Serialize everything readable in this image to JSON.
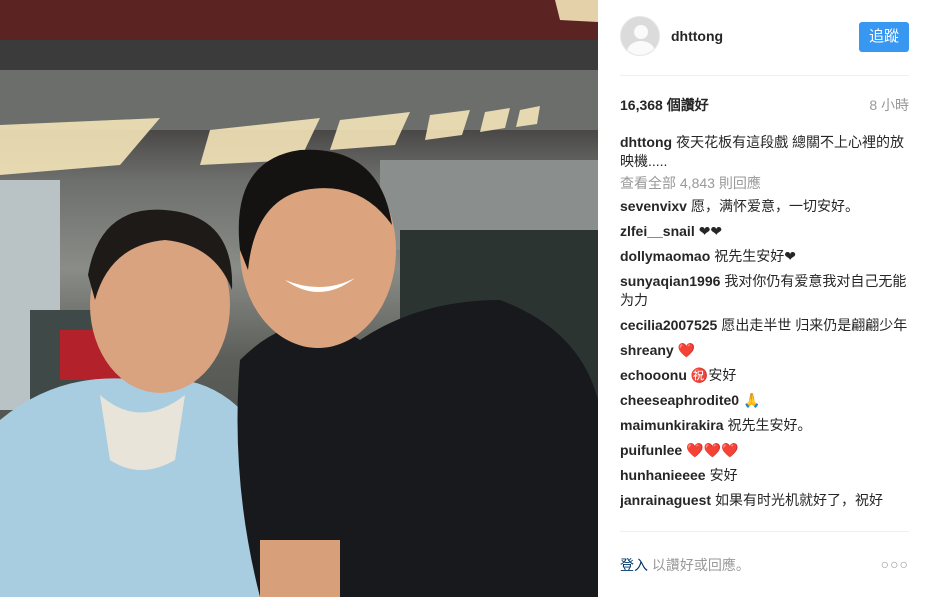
{
  "post": {
    "username": "dhttong",
    "follow_label": "追蹤",
    "likes": "16,368 個讚好",
    "time_ago": "8 小時",
    "caption": {
      "username": "dhttong",
      "text": "夜天花板有這段戲 總關不上心裡的放映機....."
    },
    "view_all": "查看全部 4,843 則回應",
    "comments": [
      {
        "username": "sevenvixv",
        "text": "愿，满怀爱意，一切安好。"
      },
      {
        "username": "zlfei__snail",
        "text": "❤❤"
      },
      {
        "username": "dollymaomao",
        "text": "祝先生安好❤"
      },
      {
        "username": "sunyaqian1996",
        "text": "我对你仍有爱意我对自己无能为力"
      },
      {
        "username": "cecilia2007525",
        "text": "愿出走半世 归来仍是翩翩少年"
      },
      {
        "username": "shreany",
        "text": "❤️"
      },
      {
        "username": "echooonu",
        "text": "㊗️安好"
      },
      {
        "username": "cheeseaphrodite0",
        "text": "🙏"
      },
      {
        "username": "maimunkirakira",
        "text": "祝先生安好。"
      },
      {
        "username": "puifunlee",
        "text": "❤️❤️❤️"
      },
      {
        "username": "hunhanieeee",
        "text": "安好"
      },
      {
        "username": "janrainaguest",
        "text": "如果有时光机就好了，祝好"
      }
    ],
    "footer": {
      "login_link": "登入",
      "login_text": "以讚好或回應。",
      "more": "○○○"
    }
  },
  "icons": {
    "avatar": "default-avatar-icon",
    "more": "more-options-icon"
  }
}
